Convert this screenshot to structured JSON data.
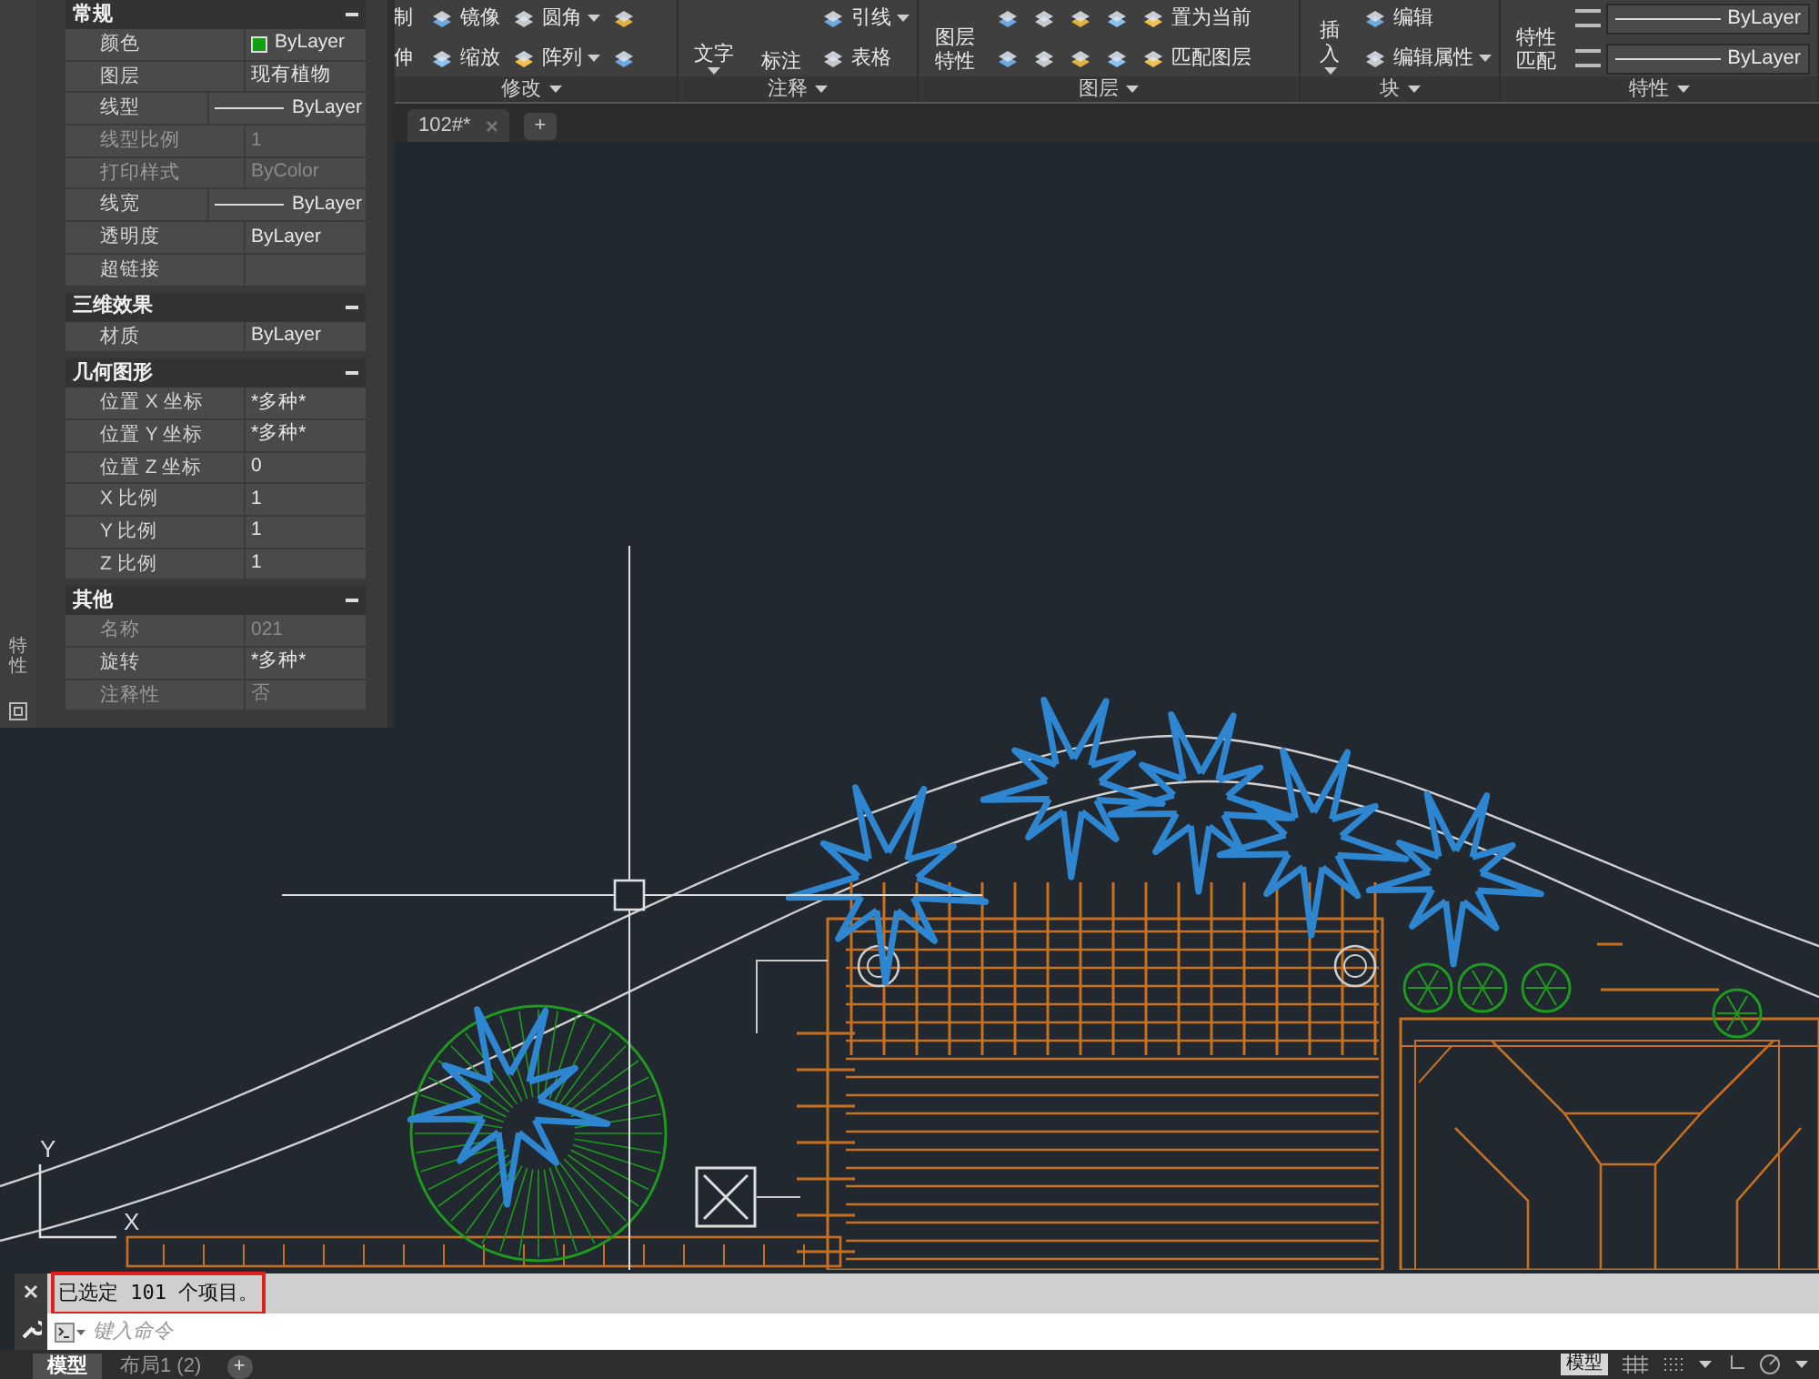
{
  "ribbon": {
    "panels": [
      {
        "label": "修改",
        "rows": [
          [
            {
              "kind": "text",
              "label": "制"
            },
            {
              "kind": "small",
              "label": "镜像",
              "dropdown": false
            },
            {
              "kind": "small",
              "label": "圆角",
              "dropdown": true
            },
            {
              "kind": "icon"
            }
          ],
          [
            {
              "kind": "text",
              "label": "伸"
            },
            {
              "kind": "small",
              "label": "缩放",
              "dropdown": false
            },
            {
              "kind": "small",
              "label": "阵列",
              "dropdown": true
            },
            {
              "kind": "icon"
            }
          ]
        ]
      },
      {
        "label": "注释",
        "large": [
          {
            "label": "文字",
            "dropdown": true
          },
          {
            "label": "标注",
            "dropdown": false
          }
        ],
        "rows": [
          [
            {
              "kind": "small",
              "label": "引线",
              "dropdown": true
            }
          ],
          [
            {
              "kind": "small",
              "label": "表格",
              "dropdown": false
            }
          ]
        ]
      },
      {
        "label": "图层",
        "large": [
          {
            "label": "图层特性",
            "dropdown": false
          }
        ],
        "rows": [
          [
            {
              "kind": "icon"
            },
            {
              "kind": "icon"
            },
            {
              "kind": "icon"
            },
            {
              "kind": "icon"
            },
            {
              "kind": "small",
              "label": "置为当前",
              "dropdown": false
            }
          ],
          [
            {
              "kind": "icon"
            },
            {
              "kind": "icon"
            },
            {
              "kind": "icon"
            },
            {
              "kind": "icon"
            },
            {
              "kind": "small",
              "label": "匹配图层",
              "dropdown": false
            }
          ]
        ]
      },
      {
        "label": "块",
        "large": [
          {
            "label": "插入",
            "dropdown": true
          }
        ],
        "rows": [
          [
            {
              "kind": "small",
              "label": "编辑",
              "dropdown": false
            }
          ],
          [
            {
              "kind": "small",
              "label": "编辑属性",
              "dropdown": true
            }
          ]
        ]
      },
      {
        "label": "特性",
        "large": [
          {
            "label": "特性匹配",
            "dropdown": false
          }
        ],
        "rows": [
          [
            {
              "kind": "field",
              "label": "ByLayer"
            }
          ],
          [
            {
              "kind": "field",
              "label": "ByLayer"
            }
          ]
        ]
      }
    ]
  },
  "document_tabs": [
    {
      "label": "102#*",
      "selected": true
    }
  ],
  "new_tab": "+",
  "properties": {
    "title": "特性",
    "sections": [
      {
        "title": "常规",
        "expanded": true,
        "rows": [
          {
            "label": "颜色",
            "kind": "color",
            "value": "ByLayer",
            "color": "#12a012",
            "disabled": false
          },
          {
            "label": "图层",
            "kind": "text",
            "value": "现有植物",
            "disabled": false
          },
          {
            "label": "线型",
            "kind": "line",
            "value": "ByLayer",
            "disabled": false
          },
          {
            "label": "线型比例",
            "kind": "text",
            "value": "1",
            "disabled": true
          },
          {
            "label": "打印样式",
            "kind": "text",
            "value": "ByColor",
            "disabled": true
          },
          {
            "label": "线宽",
            "kind": "line",
            "value": "ByLayer",
            "disabled": false
          },
          {
            "label": "透明度",
            "kind": "text",
            "value": "ByLayer",
            "disabled": false
          },
          {
            "label": "超链接",
            "kind": "text",
            "value": "",
            "disabled": false
          }
        ]
      },
      {
        "title": "三维效果",
        "expanded": true,
        "rows": [
          {
            "label": "材质",
            "kind": "text",
            "value": "ByLayer",
            "disabled": false
          }
        ]
      },
      {
        "title": "几何图形",
        "expanded": true,
        "rows": [
          {
            "label": "位置 X 坐标",
            "kind": "text",
            "value": "*多种*",
            "disabled": false
          },
          {
            "label": "位置 Y 坐标",
            "kind": "text",
            "value": "*多种*",
            "disabled": false
          },
          {
            "label": "位置 Z 坐标",
            "kind": "text",
            "value": "0",
            "disabled": false
          },
          {
            "label": "X 比例",
            "kind": "text",
            "value": "1",
            "disabled": false
          },
          {
            "label": "Y 比例",
            "kind": "text",
            "value": "1",
            "disabled": false
          },
          {
            "label": "Z 比例",
            "kind": "text",
            "value": "1",
            "disabled": false
          }
        ]
      },
      {
        "title": "其他",
        "expanded": true,
        "rows": [
          {
            "label": "名称",
            "kind": "text",
            "value": "021",
            "disabled": true
          },
          {
            "label": "旋转",
            "kind": "text",
            "value": "*多种*",
            "disabled": false
          },
          {
            "label": "注释性",
            "kind": "text",
            "value": "否",
            "disabled": true
          }
        ]
      }
    ]
  },
  "canvas": {
    "ucs_labels": [
      "Y",
      "X"
    ]
  },
  "command_line": {
    "history": "已选定 101 个项目。",
    "placeholder": "键入命令"
  },
  "layout_tabs": [
    {
      "label": "模型",
      "selected": true
    },
    {
      "label": "布局1 (2)",
      "selected": false
    }
  ],
  "add_layout": "+",
  "status_bar": {
    "model_button": "模型"
  }
}
